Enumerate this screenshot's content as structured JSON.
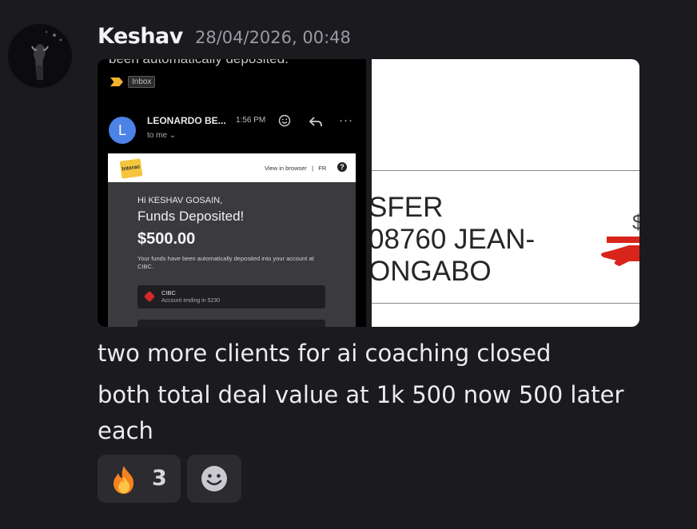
{
  "message": {
    "author": "Keshav",
    "timestamp": "28/04/2026, 00:48",
    "lines": [
      "two more clients for ai coaching closed",
      "both total deal value at 1k 500 now 500 later",
      "each"
    ]
  },
  "attachments": {
    "email_screenshot": {
      "cut_text": "been automatically deposited.",
      "label": "Inbox",
      "sender_initial": "L",
      "sender_name": "LEONARDO BE...",
      "time": "1:56 PM",
      "recipient": "to me",
      "logo_text": "Interac",
      "view_in_browser": "View in browser",
      "lang": "FR",
      "greeting": "Hi KESHAV GOSAIN,",
      "headline": "Funds Deposited!",
      "amount": "$500.00",
      "body": "Your funds have been automatically deposited into your account at CIBC.",
      "bank_name": "CIBC",
      "bank_account": "Account ending in 5230"
    },
    "cheque_screenshot": {
      "line1": "SFER",
      "line2": "08760 JEAN-",
      "line3": "ONGABO"
    }
  },
  "reactions": [
    {
      "emoji": "fire-emoji",
      "count": "3"
    }
  ],
  "colors": {
    "background": "#1b1b1f",
    "username": "#f2f3f5",
    "timestamp": "#9a9aa3",
    "reaction_bg": "#2b2b30",
    "interac_yellow": "#f5c53c",
    "cibc_red": "#d8262b",
    "gmail_avatar_blue": "#4d82e6"
  }
}
